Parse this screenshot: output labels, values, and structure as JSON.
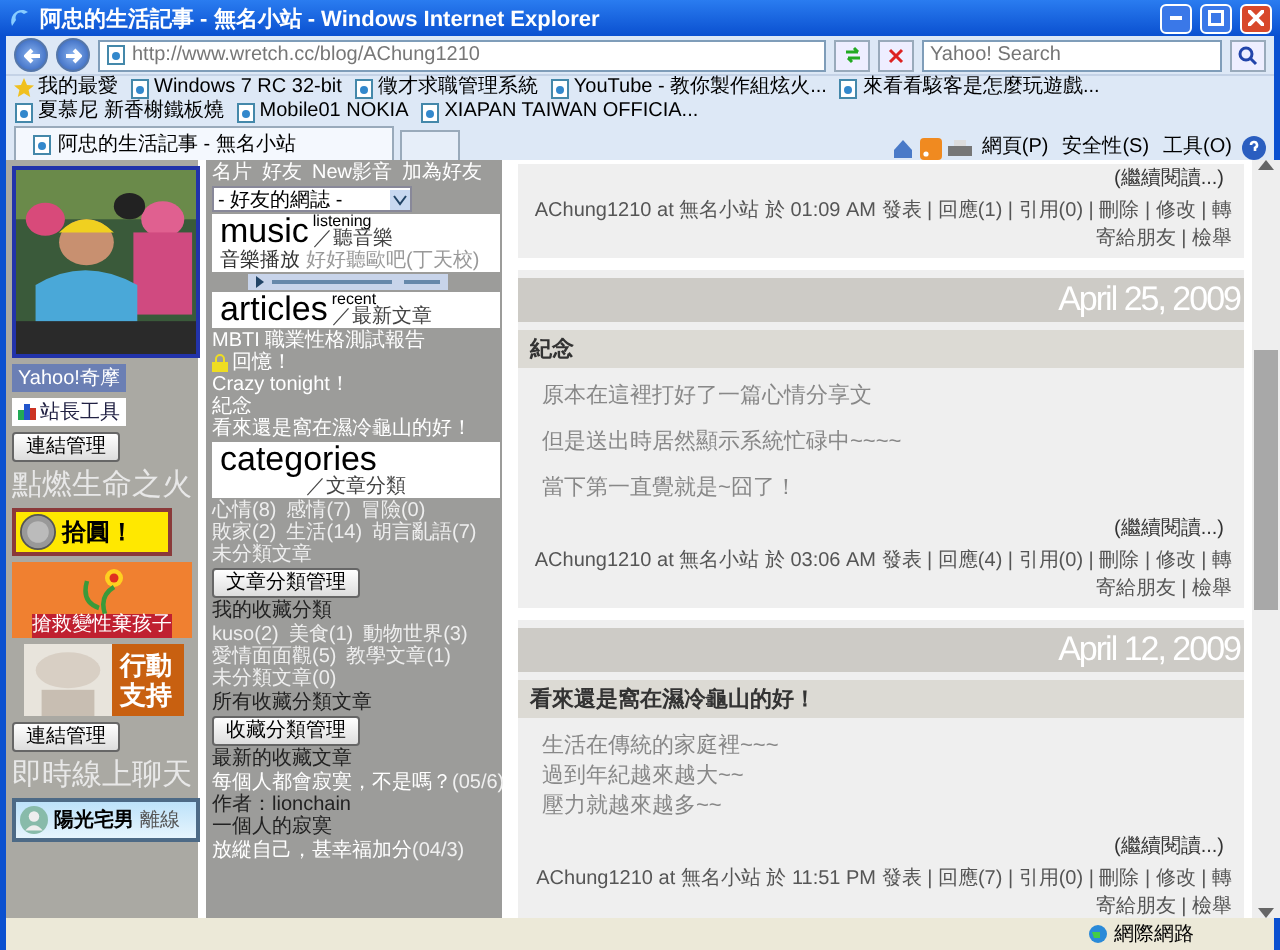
{
  "window": {
    "title": "阿忠的生活記事 - 無名小站 - Windows Internet Explorer"
  },
  "toolbar": {
    "address": "http://www.wretch.cc/blog/AChung1210",
    "search_placeholder": "Yahoo! Search"
  },
  "favorites": {
    "label": "我的最愛",
    "items": [
      "Windows 7 RC 32-bit",
      "徵才求職管理系統",
      "YouTube - 教你製作組炫火...",
      "來看看駭客是怎麼玩遊戲...",
      "夏慕尼 新香榭鐵板燒",
      "Mobile01 NOKIA",
      "XIAPAN TAIWAN OFFICIA..."
    ]
  },
  "tabs": [
    {
      "label": "阿忠的生活記事 - 無名小站",
      "selected": true
    }
  ],
  "command_bar": [
    "網頁(P)",
    "安全性(S)",
    "工具(O)"
  ],
  "sidebar": {
    "badges": [
      "Yahoo!奇摩",
      "站長工具"
    ],
    "link_button": "連結管理",
    "heading": "點燃生命之火",
    "banners": [
      {
        "kind": "coin",
        "text": "拾圓！"
      },
      {
        "kind": "flower",
        "text": "搶救變性棄孩子"
      },
      {
        "kind": "doll",
        "text": "行動支持"
      }
    ],
    "link_button_2": "連結管理",
    "chat_heading": "即時線上聊天",
    "chat": {
      "name": "陽光宅男",
      "status": "離線"
    }
  },
  "column2": {
    "links": [
      "名片",
      "好友",
      "New影音",
      "加為好友"
    ],
    "select": "- 好友的網誌 -",
    "music": {
      "title": "music",
      "sup": "listening",
      "sub": "／聽音樂",
      "now_playing": "音樂播放",
      "song": "好好聽歐吧(丁天校)"
    },
    "articles": {
      "title": "articles",
      "sup": "recent",
      "sub": "／最新文章",
      "items": [
        {
          "text": "MBTI 職業性格測試報告",
          "locked": false
        },
        {
          "text": "回憶！",
          "locked": true
        },
        {
          "text": "Crazy tonight！",
          "locked": false
        },
        {
          "text": "紀念",
          "locked": false
        },
        {
          "text": "看來還是窩在濕冷龜山的好！",
          "locked": false
        }
      ]
    },
    "categories": {
      "title": "categories",
      "sub": "／文章分類",
      "items": [
        "心情(8)",
        "感情(7)",
        "冒險(0)",
        "敗家(2)",
        "生活(14)",
        "胡言亂語(7)",
        "未分類文章"
      ],
      "button": "文章分類管理"
    },
    "collections": {
      "heading": "我的收藏分類",
      "items": [
        "kuso(2)",
        "美食(1)",
        "動物世界(3)",
        "愛情面面觀(5)",
        "教學文章(1)",
        "未分類文章(0)"
      ],
      "all": "所有收藏分類文章",
      "button": "收藏分類管理"
    },
    "latest": {
      "heading": "最新的收藏文章",
      "entries": [
        {
          "title": "每個人都會寂寞，不是嗎？",
          "date": "(05/6)",
          "author": "作者：lionchain",
          "excerpt": "一個人的寂寞"
        },
        {
          "title": "放縱自己，甚幸福加分",
          "date": "(04/3)"
        }
      ]
    }
  },
  "posts": [
    {
      "more": "(繼續閱讀...)",
      "footer": "AChung1210 at 無名小站 於 01:09 AM 發表 | 回應(1) | 引用(0) | 刪除 | 修改 | 轉寄給朋友 | 檢舉"
    },
    {
      "date": "April 25, 2009",
      "title": "紀念",
      "paragraphs": [
        "原本在這裡打好了一篇心情分享文",
        "但是送出時居然顯示系統忙碌中~~~~",
        "當下第一直覺就是~囧了！"
      ],
      "spaced": true,
      "more": "(繼續閱讀...)",
      "footer": "AChung1210 at 無名小站 於 03:06 AM 發表 | 回應(4) | 引用(0) | 刪除 | 修改 | 轉寄給朋友 | 檢舉"
    },
    {
      "date": "April 12, 2009",
      "title": "看來還是窩在濕冷龜山的好！",
      "paragraphs": [
        "生活在傳統的家庭裡~~~",
        "過到年紀越來越大~~",
        "壓力就越來越多~~"
      ],
      "spaced": false,
      "more": "(繼續閱讀...)",
      "footer": "AChung1210 at 無名小站 於 11:51 PM 發表 | 回應(7) | 引用(0) | 刪除 | 修改 | 轉寄給朋友 | 檢舉"
    }
  ],
  "status_bar": {
    "zone": "網際網路"
  }
}
